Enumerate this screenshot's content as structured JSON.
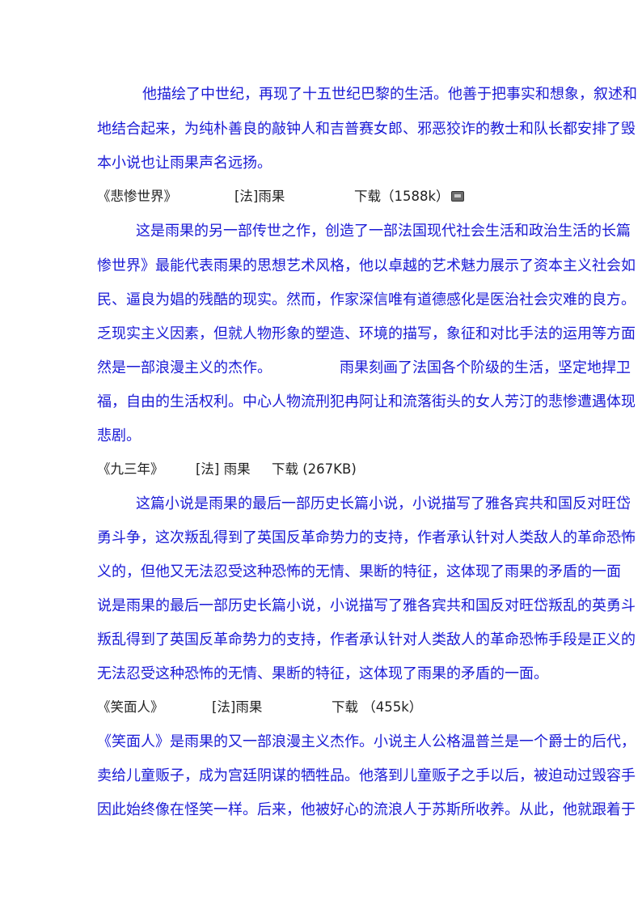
{
  "sections": {
    "intro": {
      "lines": [
        "他描绘了中世纪，再现了十五世纪巴黎的生活。他善于把事实和想象，叙述和",
        "地结合起来，为纯朴善良的敲钟人和吉普赛女郎、邪恶狡诈的教士和队长都安排了毁",
        "本小说也让雨果声名远扬。"
      ]
    },
    "les_miserables": {
      "title": "《悲惨世界》",
      "author": "[法]雨果",
      "download": "下载（1588k）",
      "icon": "download-icon",
      "lines": [
        "这是雨果的另一部传世之作，创造了一部法国现代社会生活和政治生活的长篇",
        "惨世界》最能代表雨果的思想艺术风格，他以卓越的艺术魅力展示了资本主义社会如",
        "民、逼良为娼的残酷的现实。然而，作家深信唯有道德感化是医治社会灾难的良方。",
        "乏现实主义因素，但就人物形象的塑造、环境的描写，象征和对比手法的运用等方面",
        "然是一部浪漫主义的杰作。",
        "雨果刻画了法国各个阶级的生活，坚定地捍卫",
        "福，自由的生活权利。中心人物流刑犯冉阿让和流落街头的女人芳汀的悲惨遭遇体现",
        "悲剧。"
      ]
    },
    "ninety_three": {
      "title": "《九三年》",
      "author": "[法] 雨果",
      "download": "下载 (267KB)",
      "lines": [
        "这篇小说是雨果的最后一部历史长篇小说，小说描写了雅各宾共和国反对旺岱",
        "勇斗争，这次叛乱得到了英国反革命势力的支持，作者承认针对人类敌人的革命恐怖",
        "义的，但他又无法忍受这种恐怖的无情、果断的特征，这体现了雨果的矛盾的一面",
        "说是雨果的最后一部历史长篇小说，小说描写了雅各宾共和国反对旺岱叛乱的英勇斗",
        "叛乱得到了英国反革命势力的支持，作者承认针对人类敌人的革命恐怖手段是正义的",
        "无法忍受这种恐怖的无情、果断的特征，这体现了雨果的矛盾的一面。"
      ]
    },
    "man_who_laughs": {
      "title": "《笑面人》",
      "author": "[法]雨果",
      "download": "下载 （455k）",
      "lines": [
        "《笑面人》是雨果的又一部浪漫主义杰作。小说主人公格温普兰是一个爵士的后代，",
        "卖给儿童贩子，成为宫廷阴谋的牺牲品。他落到儿童贩子之手以后，被迫动过毁容手",
        "因此始终像在怪笑一样。后来，他被好心的流浪人于苏斯所收养。从此，他就跟着于"
      ]
    }
  }
}
